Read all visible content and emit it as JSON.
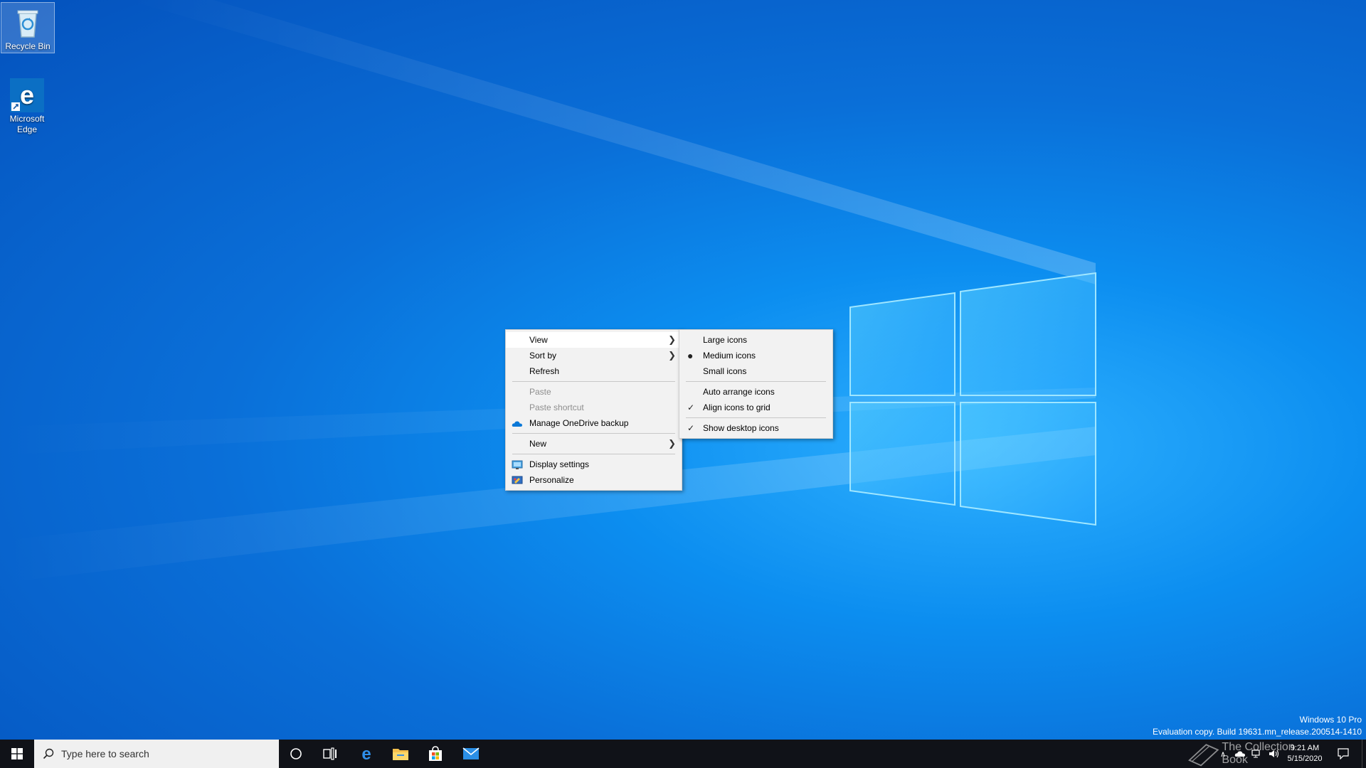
{
  "desktop": {
    "icons": [
      {
        "label": "Recycle Bin"
      },
      {
        "label": "Microsoft Edge"
      }
    ]
  },
  "context_menu": {
    "items": [
      {
        "label": "View"
      },
      {
        "label": "Sort by"
      },
      {
        "label": "Refresh"
      },
      {
        "label": "Paste"
      },
      {
        "label": "Paste shortcut"
      },
      {
        "label": "Manage OneDrive backup"
      },
      {
        "label": "New"
      },
      {
        "label": "Display settings"
      },
      {
        "label": "Personalize"
      }
    ]
  },
  "view_submenu": {
    "items": [
      {
        "label": "Large icons"
      },
      {
        "label": "Medium icons"
      },
      {
        "label": "Small icons"
      },
      {
        "label": "Auto arrange icons"
      },
      {
        "label": "Align icons to grid"
      },
      {
        "label": "Show desktop icons"
      }
    ]
  },
  "taskbar": {
    "search_placeholder": "Type here to search",
    "time": "9:21 AM",
    "date": "5/15/2020"
  },
  "watermark": {
    "line1": "Windows 10 Pro",
    "line2": "Evaluation copy. Build 19631.mn_release.200514-1410"
  },
  "overlay_text": "The Collection Book",
  "colors": {
    "accent": "#0a78d7",
    "taskbar": "#101218",
    "menu_bg": "#f2f2f2"
  }
}
